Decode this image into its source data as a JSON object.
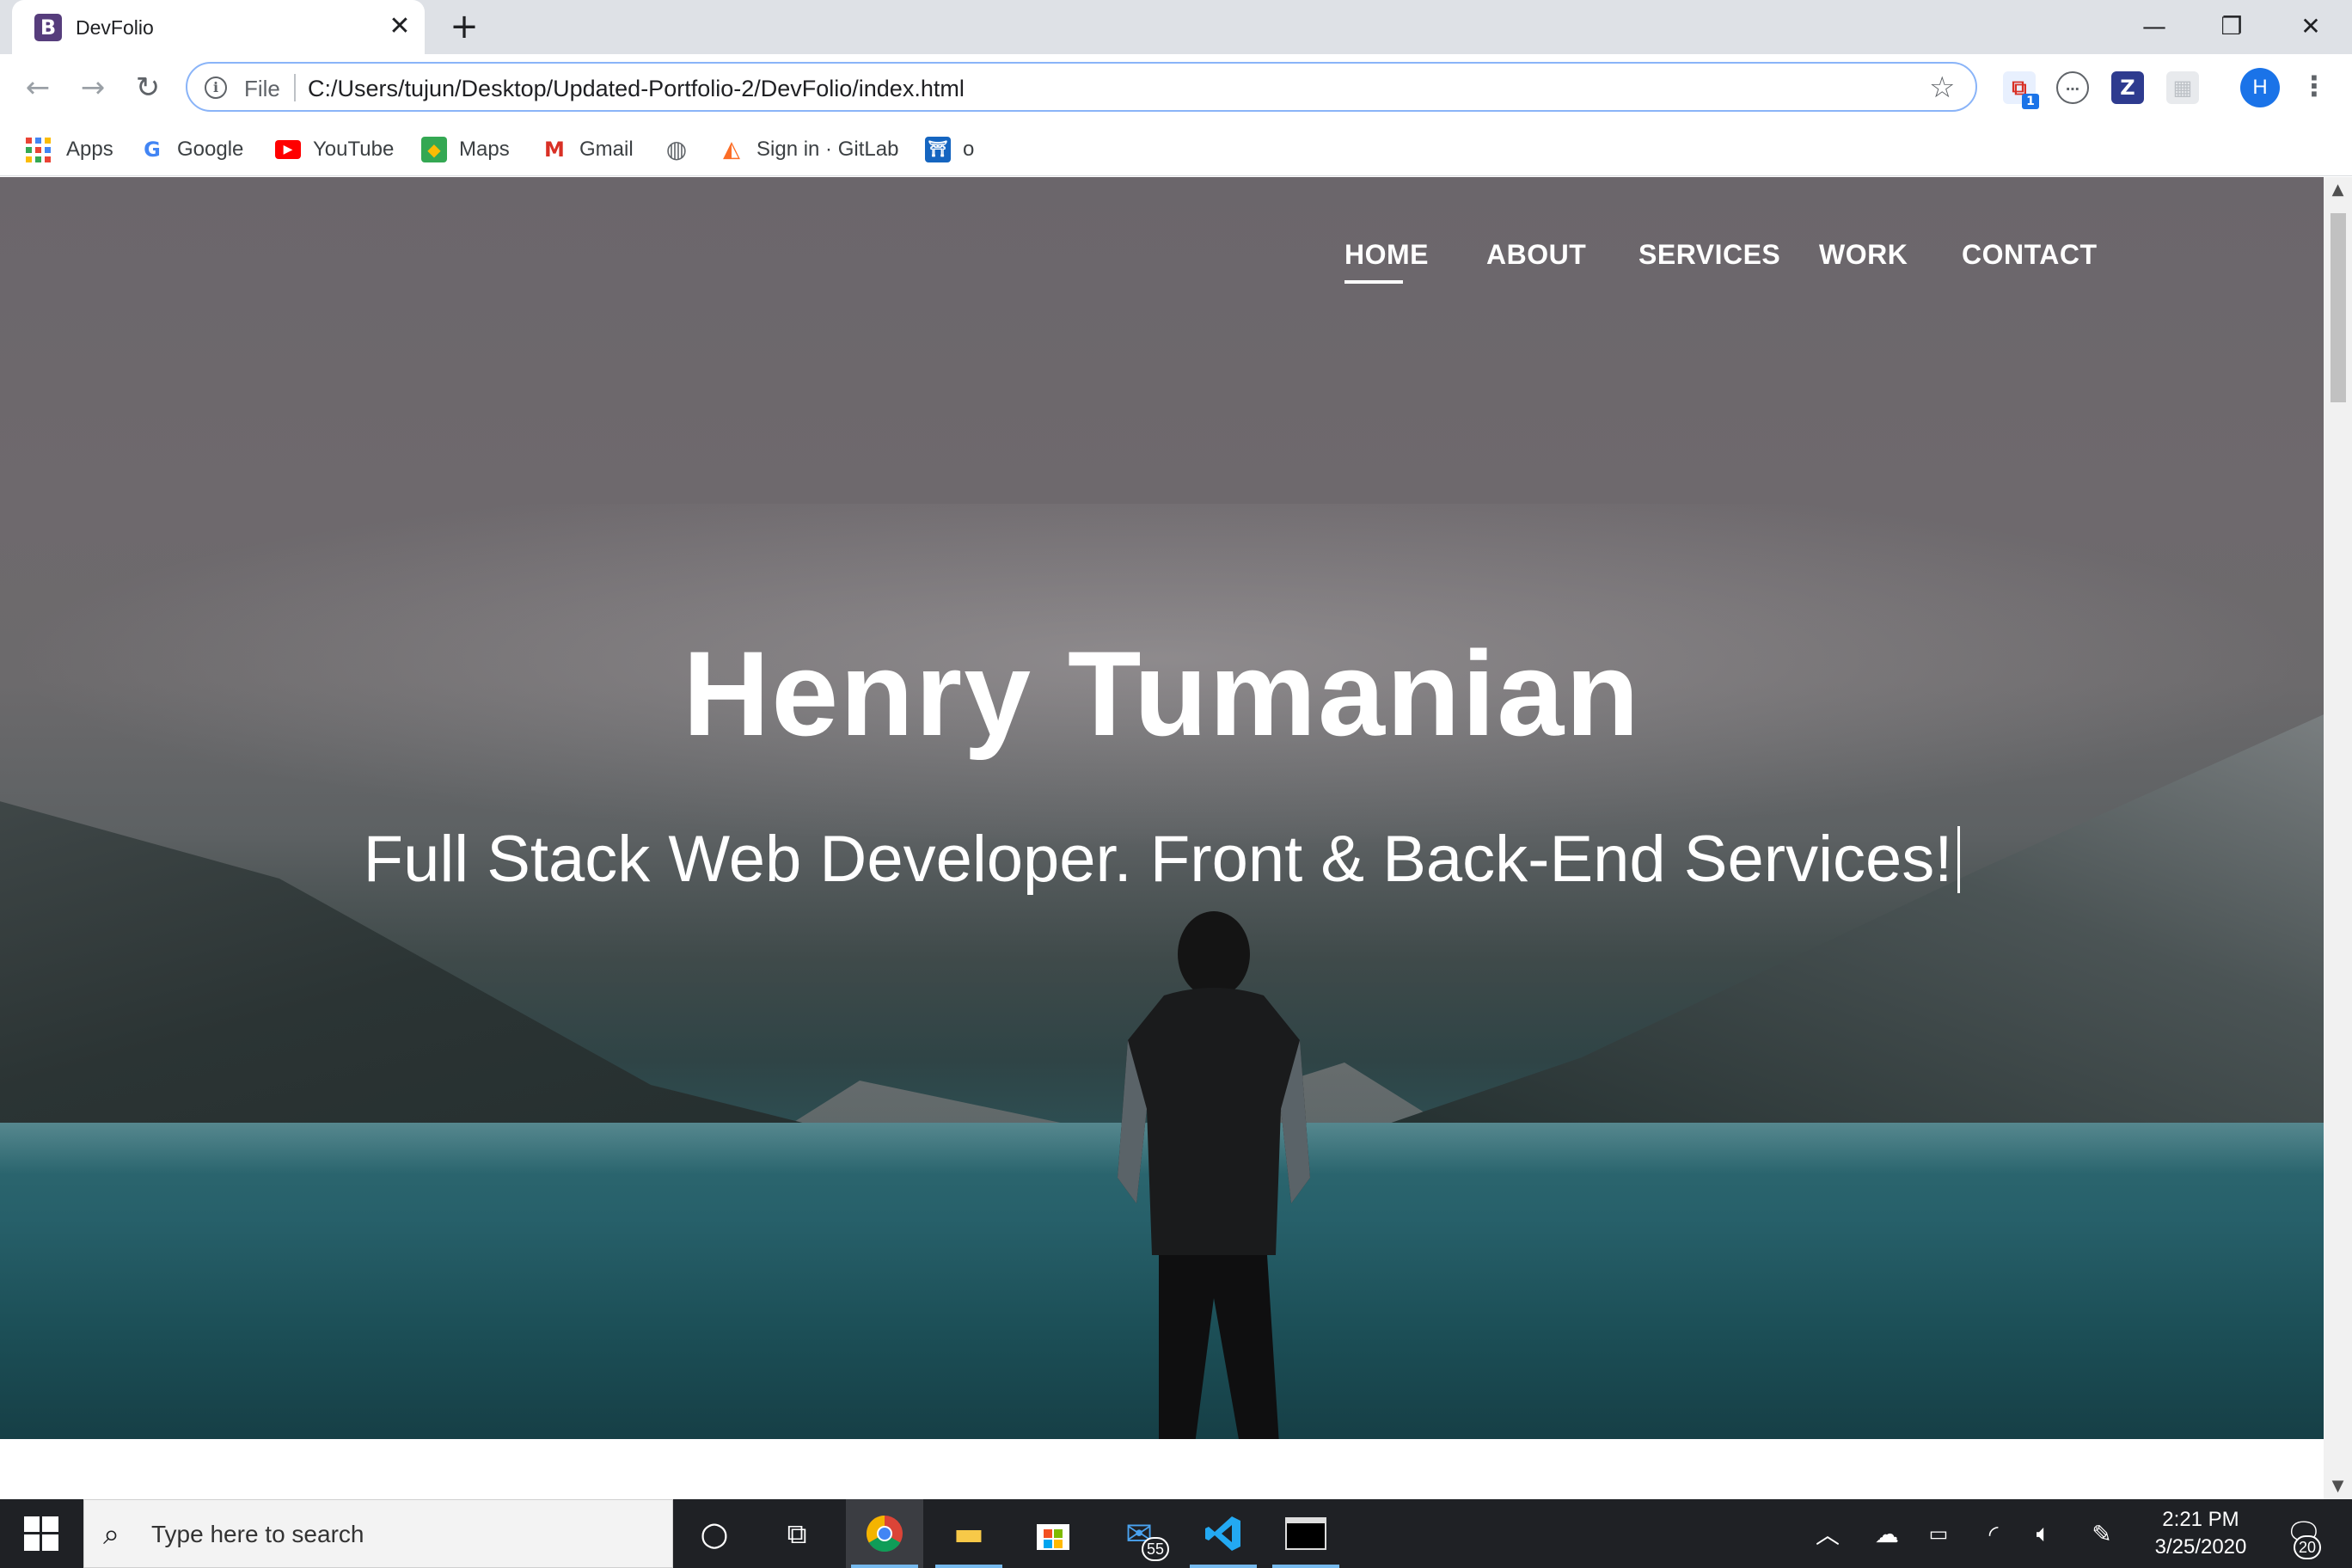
{
  "browser": {
    "tab": {
      "favicon_letter": "B",
      "title": "DevFolio"
    },
    "new_tab_symbol": "+",
    "window_controls": {
      "minimize": "—",
      "restore": "❐",
      "close": "✕"
    },
    "nav": {
      "back": "←",
      "forward": "→",
      "reload": "↻"
    },
    "omnibox": {
      "scheme_label": "File",
      "url": "C:/Users/tujun/Desktop/Updated-Portfolio-2/DevFolio/index.html"
    },
    "extensions": [
      {
        "name": "extension-icon-1",
        "badge": "1"
      },
      {
        "name": "extension-icon-2"
      },
      {
        "name": "extension-z-icon",
        "label": "Z"
      },
      {
        "name": "extension-icon-4"
      }
    ],
    "profile_initial": "H",
    "bookmarks": [
      {
        "label": "Apps",
        "icon": "apps-grid-icon"
      },
      {
        "label": "Google",
        "icon": "google-icon"
      },
      {
        "label": "YouTube",
        "icon": "youtube-icon"
      },
      {
        "label": "Maps",
        "icon": "maps-icon"
      },
      {
        "label": "Gmail",
        "icon": "gmail-icon"
      },
      {
        "label": "",
        "icon": "globe-icon"
      },
      {
        "label": "Sign in · GitLab",
        "icon": "gitlab-icon"
      },
      {
        "label": "o",
        "icon": "bookmark-app-icon"
      }
    ]
  },
  "page": {
    "nav": {
      "items": [
        "HOME",
        "ABOUT",
        "SERVICES",
        "WORK",
        "CONTACT"
      ],
      "active": "HOME"
    },
    "hero": {
      "title": "Henry Tumanian",
      "subtitle": "Full Stack Web Developer. Front & Back-End Services!"
    }
  },
  "taskbar": {
    "search_placeholder": "Type here to search",
    "apps": [
      {
        "name": "cortana-icon"
      },
      {
        "name": "task-view-icon"
      },
      {
        "name": "chrome-icon",
        "active": true
      },
      {
        "name": "file-explorer-icon",
        "running": true
      },
      {
        "name": "microsoft-store-icon"
      },
      {
        "name": "mail-icon",
        "badge": "55"
      },
      {
        "name": "vscode-icon",
        "running": true
      },
      {
        "name": "terminal-icon",
        "running": true
      }
    ],
    "clock": {
      "time": "2:21 PM",
      "date": "3/25/2020"
    },
    "notifications_count": "20"
  },
  "colors": {
    "chrome_tabstrip": "#dee1e6",
    "omnibox_focus": "#8ab4f8",
    "taskbar_bg": "#1f2125",
    "taskbar_accent": "#76b9ed",
    "hero_text": "#ffffff"
  }
}
